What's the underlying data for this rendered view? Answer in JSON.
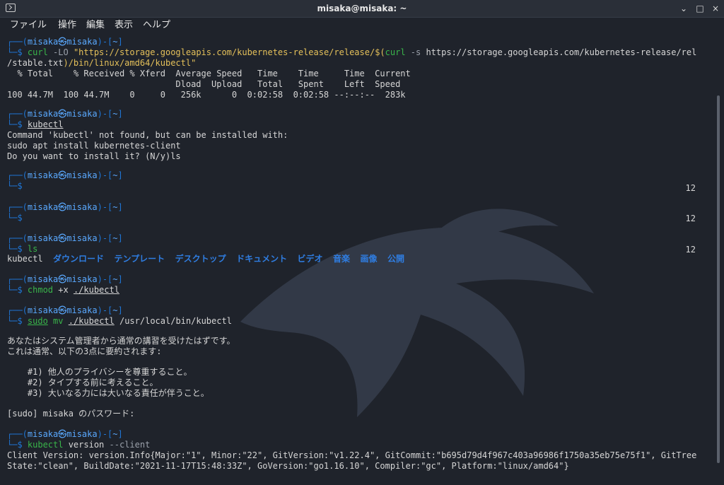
{
  "window": {
    "title": "misaka@misaka: ~"
  },
  "menu": [
    "ファイル",
    "操作",
    "編集",
    "表示",
    "ヘルプ"
  ],
  "terminal": {
    "prompt": {
      "tl": "┌──(",
      "user": "misaka㉿misaka",
      "dash": ")-[",
      "dir": "~",
      "end": "]",
      "arrow": "└─$ "
    },
    "p1": {
      "cmd_1": "curl",
      "flag_1": " -LO ",
      "url_1": "\"https://storage.googleapis.com/kubernetes-release/release/$(",
      "cmd_2": "curl",
      "flag_2": " -s ",
      "url_2": "https://storage.googleapis.com/kubernetes-release/rel",
      "cont_1": "/stable.txt",
      "cont_2": ")/bin/linux/amd64/kubectl\"",
      "header_1": "  % Total    % Received % Xferd  Average Speed   Time    Time     Time  Current",
      "header_2": "                                 Dload  Upload   Total   Spent    Left  Speed",
      "stats": "100 44.7M  100 44.7M    0     0   256k      0  0:02:58  0:02:58 --:--:--  283k"
    },
    "p2": {
      "cmd": "kubectl",
      "out_1": "Command 'kubectl' not found, but can be installed with:",
      "out_2": "sudo apt install kubernetes-client",
      "out_3": "Do you want to install it? (N/y)ls"
    },
    "rn_1": "12",
    "rn_2": "12",
    "rn_3": "12",
    "p5": {
      "cmd": "ls",
      "ls": [
        "kubectl",
        "ダウンロード",
        "テンプレート",
        "デスクトップ",
        "ドキュメント",
        "ビデオ",
        "音楽",
        "画像",
        "公開"
      ]
    },
    "p6": {
      "cmd": "chmod",
      "args": " +x ",
      "path": "./kubectl"
    },
    "p7": {
      "cmd_1": "sudo",
      "cmd_2": " mv ",
      "path": "./kubectl",
      "arg": " /usr/local/bin/kubectl",
      "out_1": "あなたはシステム管理者から通常の講習を受けたはずです。",
      "out_2": "これは通常、以下の3点に要約されます:",
      "out_3": "    #1) 他人のプライバシーを尊重すること。",
      "out_4": "    #2) タイプする前に考えること。",
      "out_5": "    #3) 大いなる力には大いなる責任が伴うこと。",
      "out_6": "[sudo] misaka のパスワード:"
    },
    "p8": {
      "cmd": "kubectl",
      "arg": " version ",
      "flag": "--client",
      "out_1": "Client Version: version.Info{Major:\"1\", Minor:\"22\", GitVersion:\"v1.22.4\", GitCommit:\"b695d79d4f967c403a96986f1750a35eb75e75f1\", GitTree",
      "out_2": "State:\"clean\", BuildDate:\"2021-11-17T15:48:33Z\", GoVersion:\"go1.16.10\", Compiler:\"gc\", Platform:\"linux/amd64\"}"
    }
  },
  "colors": {
    "background": "#1f232b",
    "prompt_blue": "#1f76d6",
    "prompt_cyan": "#5aa9ff",
    "directory_blue": "#2f7de1",
    "command_green": "#39b54a"
  },
  "icons": [
    "terminal-icon",
    "minimize-icon",
    "restore-icon",
    "close-icon",
    "dragon-watermark"
  ]
}
